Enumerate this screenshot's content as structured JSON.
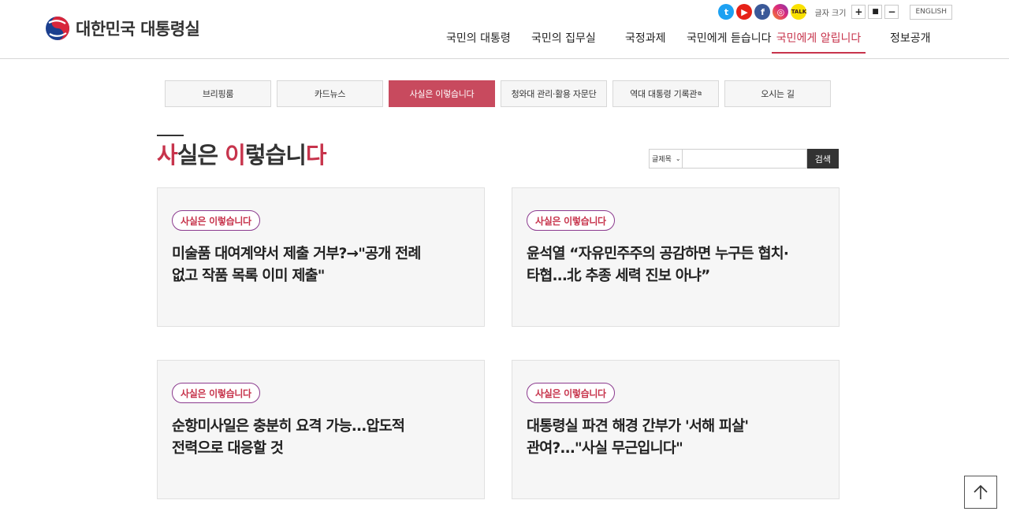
{
  "header": {
    "logo_text": "대한민국 대통령실",
    "sns": [
      {
        "name": "twitter-icon",
        "glyph": "t"
      },
      {
        "name": "youtube-icon",
        "glyph": "▶"
      },
      {
        "name": "facebook-icon",
        "glyph": "f"
      },
      {
        "name": "instagram-icon",
        "glyph": "◎"
      },
      {
        "name": "kakao-icon",
        "glyph": "TALK"
      }
    ],
    "font_size_label": "글자 크기",
    "font_plus": "+",
    "font_reset": "■",
    "font_minus": "−",
    "lang_label": "ENGLISH",
    "nav": [
      "국민의 대통령",
      "국민의 집무실",
      "국정과제",
      "국민에게 듣습니다",
      "국민에게 알립니다",
      "정보공개"
    ],
    "nav_active": 4
  },
  "tabs": [
    "브리핑룸",
    "카드뉴스",
    "사실은 이렇습니다",
    "청와대 관리·활용 자문단",
    "역대 대통령 기록관",
    "오시는 길"
  ],
  "tab_external_icon": "⧉",
  "tabs_active": 2,
  "page_title": {
    "c1": "사",
    "c2": "실은 ",
    "c3": "이",
    "c4": "렇습니",
    "c5": "다"
  },
  "search": {
    "select_value": "글제목",
    "placeholder": "",
    "button_label": "검색"
  },
  "cards": [
    {
      "badge": "사실은 이렇습니다",
      "title": "미술품 대여계약서 제출 거부?→\"공개 전례\n없고 작품 목록 이미 제출\""
    },
    {
      "badge": "사실은 이렇습니다",
      "title": "윤석열 “자유민주주의 공감하면 누구든 협치·\n타협...北 추종 세력 진보 아냐”"
    },
    {
      "badge": "사실은 이렇습니다",
      "title": "순항미사일은 충분히 요격 가능...압도적\n전력으로 대응할 것"
    },
    {
      "badge": "사실은 이렇습니다",
      "title": "대통령실 파견 해경 간부가 '서해 피살'\n관여?...\"사실 무근입니다\""
    }
  ],
  "colors": {
    "accent": "#c7344c",
    "badge_border": "#8b3a8e",
    "dark": "#333333"
  },
  "top_button_icon": "arrow-up-icon"
}
